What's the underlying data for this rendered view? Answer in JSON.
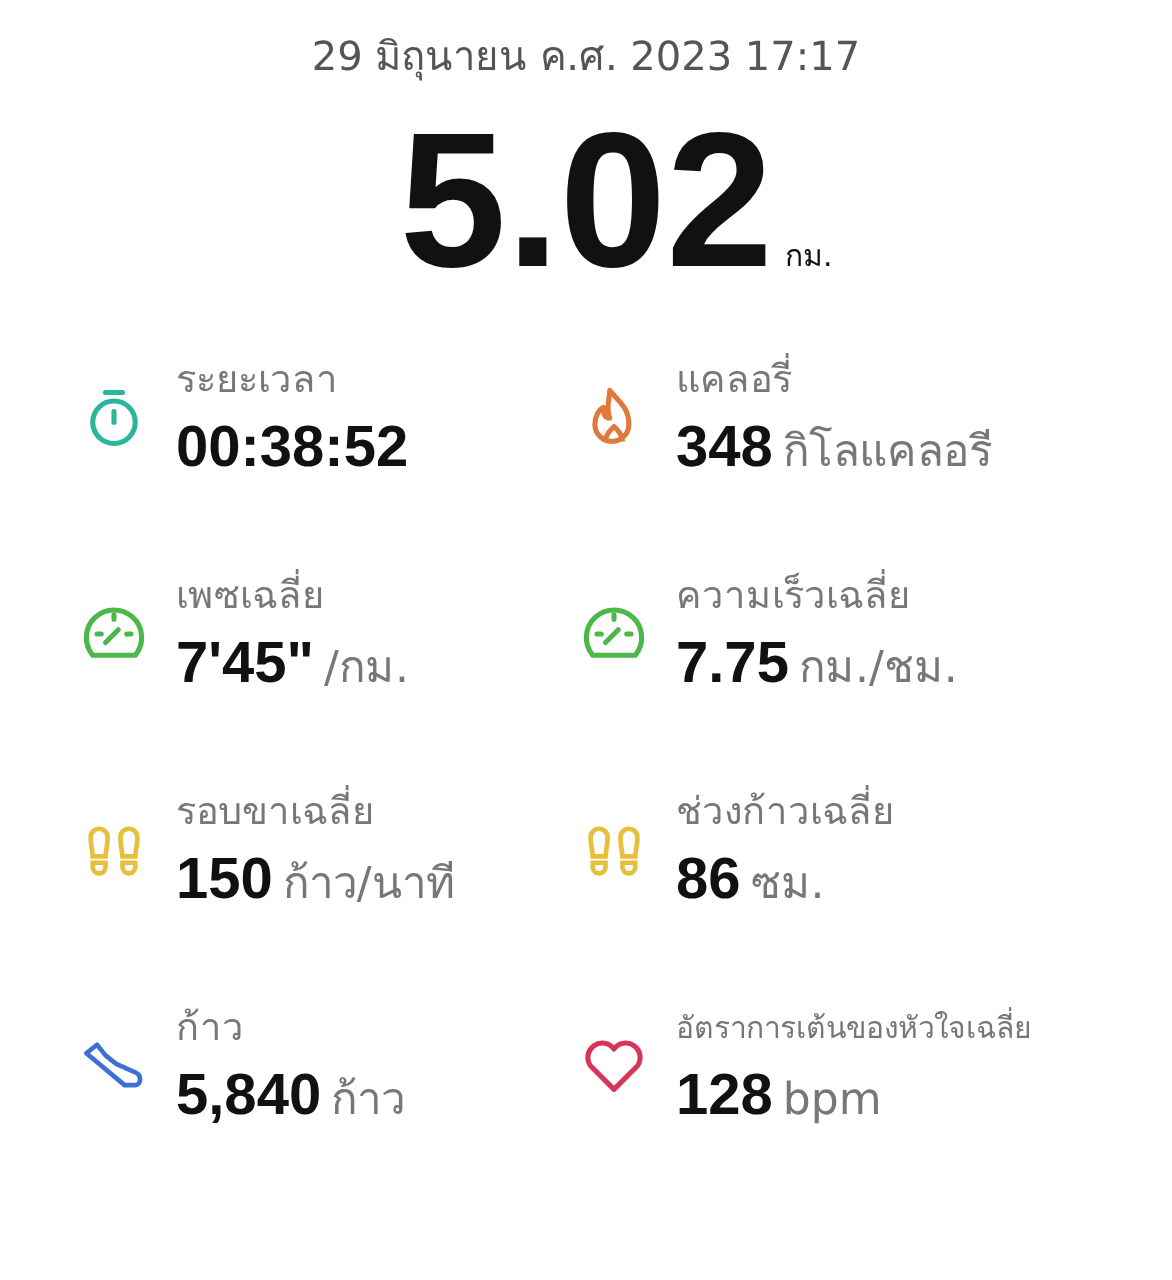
{
  "date": "29 มิถุนายน ค.ศ. 2023 17:17",
  "distance": {
    "value": "5.02",
    "unit": "กม."
  },
  "metrics": [
    {
      "kind": "stopwatch",
      "label": "ระยะเวลา",
      "value": "00:38:52"
    },
    {
      "kind": "flame",
      "label": "แคลอรี่",
      "value": "348",
      "unit": "กิโลแคลอรี"
    },
    {
      "kind": "gauge",
      "label": "เพซเฉลี่ย",
      "value": "7'45\"",
      "unit": "/กม."
    },
    {
      "kind": "gauge",
      "label": "ความเร็วเฉลี่ย",
      "value": "7.75",
      "unit": "กม./ชม."
    },
    {
      "kind": "feet",
      "label": "รอบขาเฉลี่ย",
      "value": "150",
      "unit": "ก้าว/นาที"
    },
    {
      "kind": "feet",
      "label": "ช่วงก้าวเฉลี่ย",
      "value": "86",
      "unit": "ซม."
    },
    {
      "kind": "shoe",
      "label": "ก้าว",
      "value": "5,840",
      "unit": "ก้าว"
    },
    {
      "kind": "heart",
      "label": "อัตราการเต้นของหัวใจเฉลี่ย",
      "value": "128",
      "unit": "bpm"
    }
  ]
}
